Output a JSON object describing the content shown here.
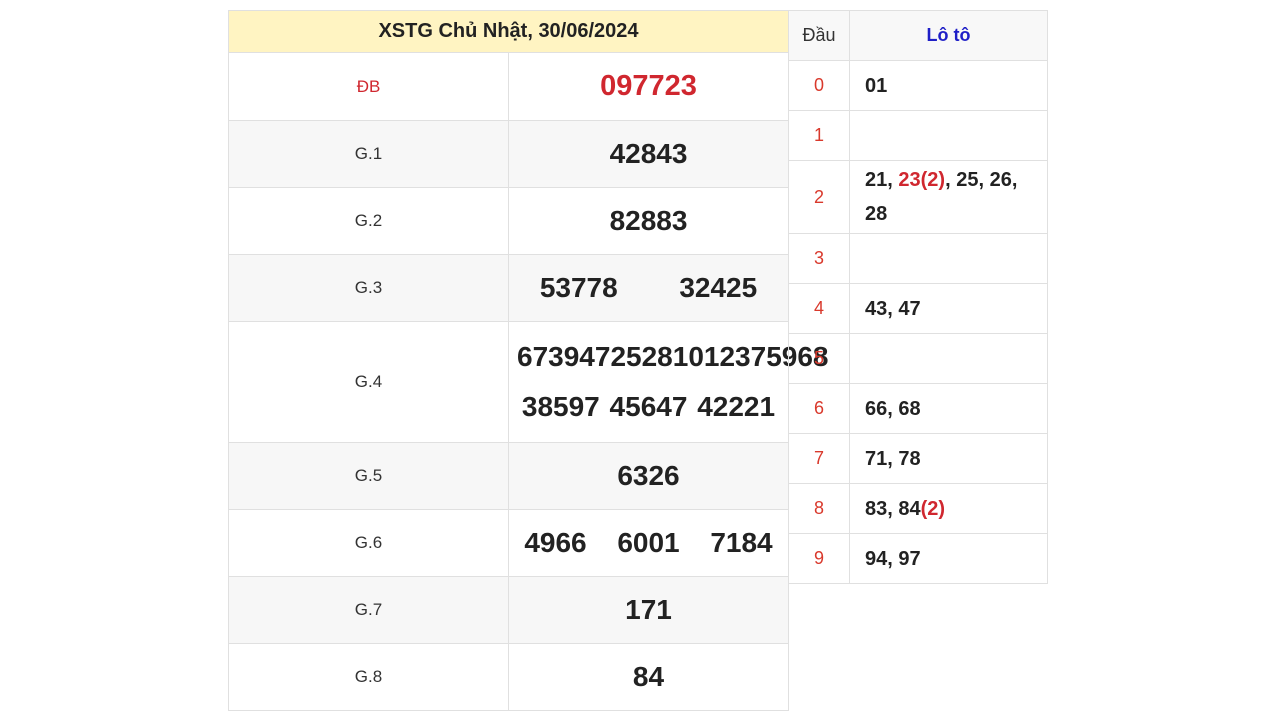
{
  "results": {
    "title": "XSTG Chủ Nhật, 30/06/2024",
    "prizes": [
      {
        "label": "ĐB",
        "numbers": [
          "097723"
        ]
      },
      {
        "label": "G.1",
        "numbers": [
          "42843"
        ]
      },
      {
        "label": "G.2",
        "numbers": [
          "82883"
        ]
      },
      {
        "label": "G.3",
        "numbers": [
          "53778",
          "32425"
        ]
      },
      {
        "label": "G.4",
        "numbers": [
          "67394",
          "72528",
          "10123",
          "75968",
          "38597",
          "45647",
          "42221"
        ]
      },
      {
        "label": "G.5",
        "numbers": [
          "6326"
        ]
      },
      {
        "label": "G.6",
        "numbers": [
          "4966",
          "6001",
          "7184"
        ]
      },
      {
        "label": "G.7",
        "numbers": [
          "171"
        ]
      },
      {
        "label": "G.8",
        "numbers": [
          "84"
        ]
      }
    ]
  },
  "loto": {
    "header_dau": "Đầu",
    "header_loto": "Lô tô",
    "rows": [
      {
        "dau": "0",
        "items": [
          {
            "text": "01"
          }
        ]
      },
      {
        "dau": "1",
        "items": []
      },
      {
        "dau": "2",
        "items": [
          {
            "text": "21"
          },
          {
            "text": "23(2)",
            "highlight": "all"
          },
          {
            "text": "25"
          },
          {
            "text": "26"
          },
          {
            "text": "28"
          }
        ]
      },
      {
        "dau": "3",
        "items": []
      },
      {
        "dau": "4",
        "items": [
          {
            "text": "43"
          },
          {
            "text": "47"
          }
        ]
      },
      {
        "dau": "5",
        "items": []
      },
      {
        "dau": "6",
        "items": [
          {
            "text": "66"
          },
          {
            "text": "68"
          }
        ]
      },
      {
        "dau": "7",
        "items": [
          {
            "text": "71"
          },
          {
            "text": "78"
          }
        ]
      },
      {
        "dau": "8",
        "items": [
          {
            "text": "83"
          },
          {
            "text": "84",
            "count": "(2)"
          }
        ]
      },
      {
        "dau": "9",
        "items": [
          {
            "text": "94"
          },
          {
            "text": "97"
          }
        ]
      }
    ]
  },
  "colors": {
    "title_bg": "#fff4c2",
    "special_red": "#d0272f",
    "dau_red": "#d9392c",
    "loto_head_blue": "#1f1fc7"
  }
}
